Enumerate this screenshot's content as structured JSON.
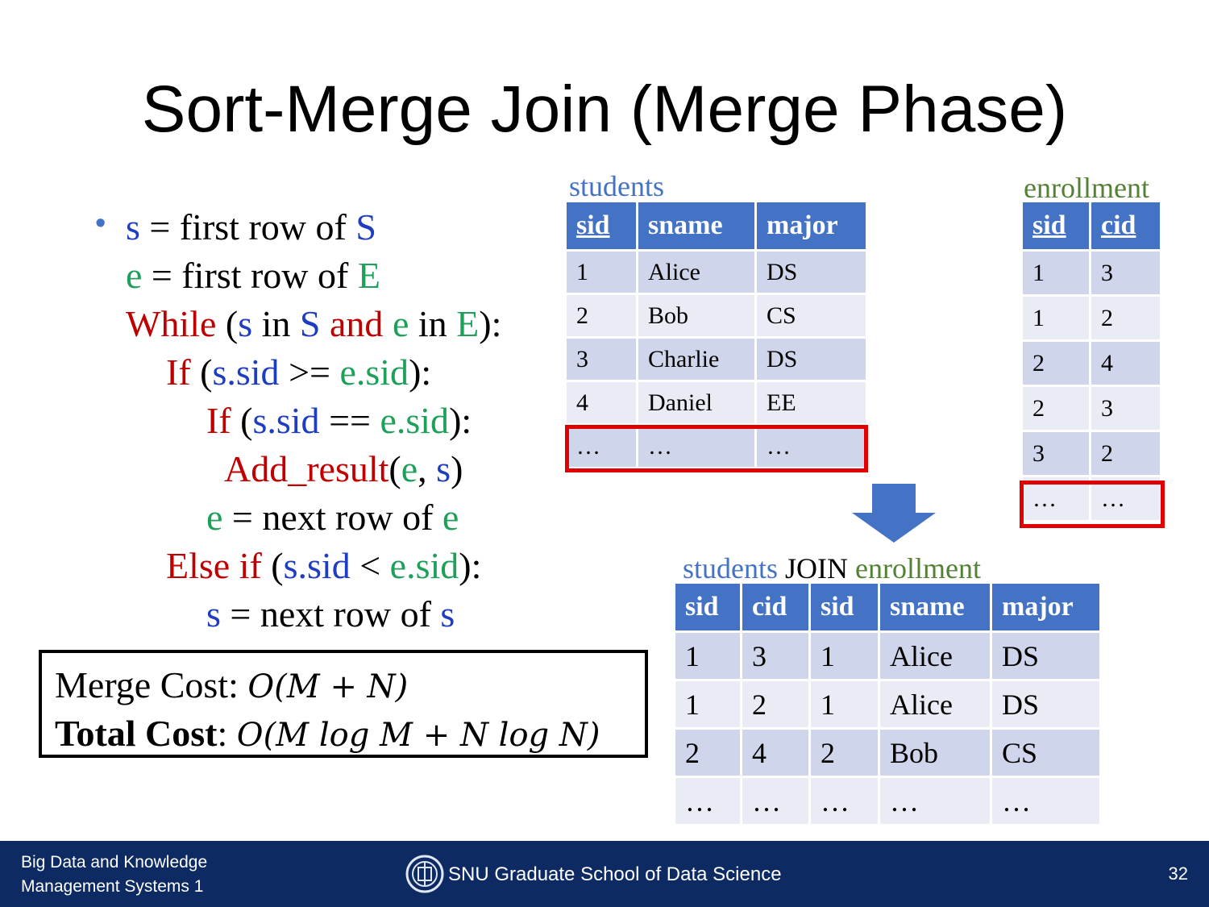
{
  "title": "Sort-Merge Join (Merge Phase)",
  "code": {
    "bullet": "•",
    "l1": {
      "a": "s",
      "b": " = first row of ",
      "c": "S"
    },
    "l2": {
      "a": "e",
      "b": " = first row of ",
      "c": "E"
    },
    "l3": {
      "a": "While",
      "b": " (",
      "c": "s",
      "d": " in ",
      "e": "S",
      "f": " and ",
      "g": "e",
      "h": " in ",
      "i": "E",
      "j": "):"
    },
    "l4": {
      "a": "If",
      "b": " (",
      "c": "s.sid",
      "d": " >= ",
      "e": "e.sid",
      "f": "):"
    },
    "l5": {
      "a": "If",
      "b": " (",
      "c": "s.sid",
      "d": " == ",
      "e": "e.sid",
      "f": "):"
    },
    "l6": {
      "a": "Add_result",
      "b": "(",
      "c": "e",
      "d": ", ",
      "e": "s",
      "f": ")"
    },
    "l7": {
      "a": "e",
      "b": " = next row of ",
      "c": "e"
    },
    "l8": {
      "a": "Else if",
      "b": " (",
      "c": "s.sid",
      "d": " < ",
      "e": "e.sid",
      "f": "):"
    },
    "l9": {
      "a": "s",
      "b": " = next row of ",
      "c": "s"
    }
  },
  "cost": {
    "merge_label": "Merge Cost: ",
    "merge_expr": "O(M + N)",
    "total_label": "Total Cost",
    "colon": ": ",
    "total_expr": "O(M log M + N log N)"
  },
  "students": {
    "label": "students",
    "headers": [
      "sid",
      "sname",
      "major"
    ],
    "rows": [
      [
        "1",
        "Alice",
        "DS"
      ],
      [
        "2",
        "Bob",
        "CS"
      ],
      [
        "3",
        "Charlie",
        "DS"
      ],
      [
        "4",
        "Daniel",
        "EE"
      ],
      [
        "…",
        "…",
        "…"
      ]
    ]
  },
  "enrollment": {
    "label": "enrollment",
    "headers": [
      "sid",
      "cid"
    ],
    "rows": [
      [
        "1",
        "3"
      ],
      [
        "1",
        "2"
      ],
      [
        "2",
        "4"
      ],
      [
        "2",
        "3"
      ],
      [
        "3",
        "2"
      ],
      [
        "…",
        "…"
      ]
    ]
  },
  "join": {
    "label_a": "students",
    "label_b": " JOIN ",
    "label_c": "enrollment",
    "headers": [
      "sid",
      "cid",
      "sid",
      "sname",
      "major"
    ],
    "rows": [
      [
        "1",
        "3",
        "1",
        "Alice",
        "DS"
      ],
      [
        "1",
        "2",
        "1",
        "Alice",
        "DS"
      ],
      [
        "2",
        "4",
        "2",
        "Bob",
        "CS"
      ],
      [
        "…",
        "…",
        "…",
        "…",
        "…"
      ]
    ]
  },
  "footer": {
    "course_line1": "Big Data and Knowledge",
    "course_line2": "Management Systems 1",
    "school": "SNU Graduate School of Data Science",
    "page": "32"
  },
  "colors": {
    "header_blue": "#4472c4",
    "row_dark": "#cfd5ea",
    "row_light": "#e9ebf5",
    "highlight_red": "#e00000",
    "footer_navy": "#0d2a63"
  }
}
